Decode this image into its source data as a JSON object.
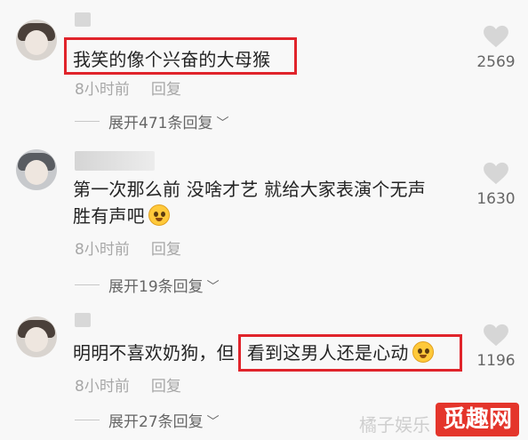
{
  "comments": [
    {
      "text": "我笑的像个兴奋的大母猴",
      "time": "8小时前",
      "reply_label": "回复",
      "expand_label": "展开471条回复",
      "likes": "2569"
    },
    {
      "text_line1": "第一次那么前 没啥才艺 就给大家表演个无声",
      "text_line2": "胜有声吧",
      "time": "8小时前",
      "reply_label": "回复",
      "expand_label": "展开19条回复",
      "likes": "1630"
    },
    {
      "text_part1": "明明不喜欢奶狗，但",
      "text_part2": "看到这男人还是心动",
      "time": "8小时前",
      "reply_label": "回复",
      "expand_label": "展开27条回复",
      "likes": "1196"
    }
  ],
  "icons": {
    "like": "heart-icon",
    "expand": "chevron-down-icon",
    "emoji": "face-emoji-icon"
  },
  "watermark": {
    "text": "橘子娱乐",
    "badge": "觅趣网"
  },
  "colors": {
    "highlight": "#e0242b",
    "background": "#f8f8f8"
  }
}
